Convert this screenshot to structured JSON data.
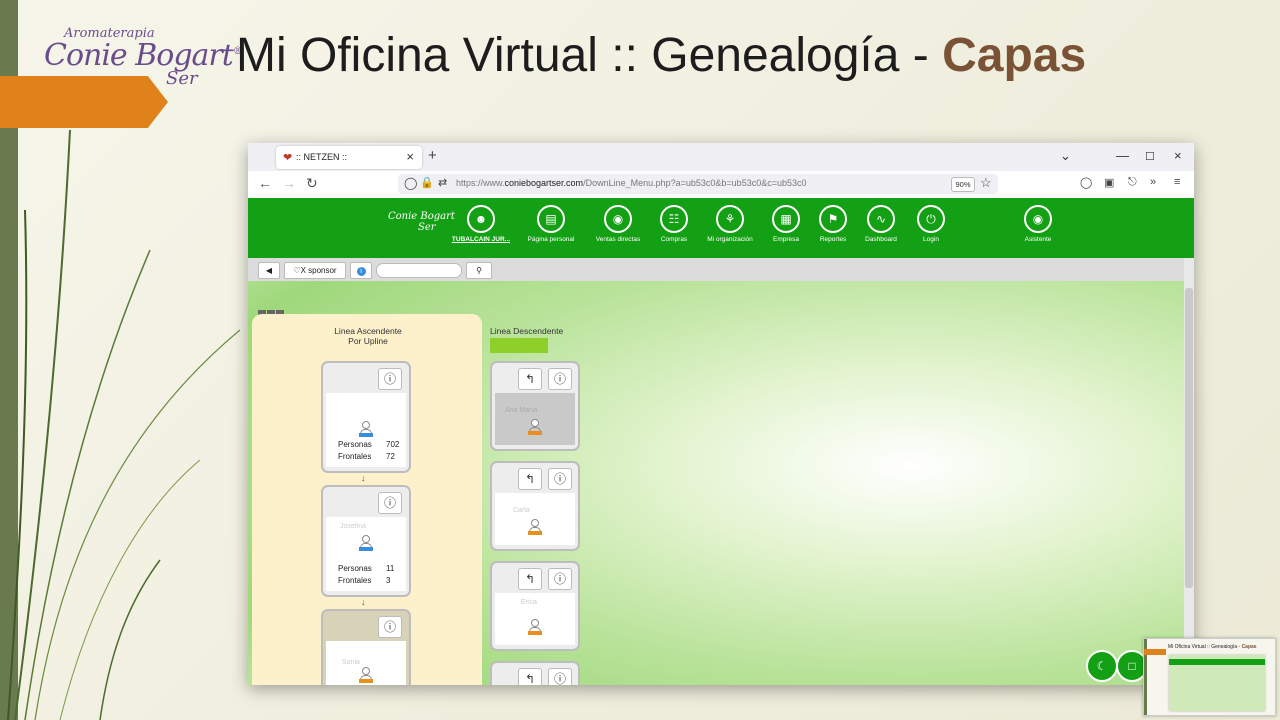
{
  "slide": {
    "logo_top": "Aromaterapia",
    "logo_main": "Conie Bogart",
    "logo_reg": "®",
    "logo_sub": "Ser",
    "title_prefix": "Mi Oficina Virtual :: Genealogía - ",
    "title_emphasis": "Capas",
    "colors": {
      "accent_orange": "#e0821c",
      "title_brown": "#7a5236",
      "strip_green": "#6a7a4f"
    }
  },
  "browser": {
    "tab_title": ":: NETZEN ::",
    "url_prefix": "https://www.",
    "url_domain": "coniebogartser.com",
    "url_path": "/DownLine_Menu.php?a=ub53c0&b=ub53c0&c=ub53c0",
    "zoom": "90%"
  },
  "site": {
    "logo": "Conie Bogart",
    "logo_sub": "Ser",
    "menu": [
      {
        "label": "TUBALCAIN JUR...",
        "icon": "user-icon"
      },
      {
        "label": "Página personal",
        "icon": "page-icon"
      },
      {
        "label": "Ventas directas",
        "icon": "bag-icon"
      },
      {
        "label": "Compras",
        "icon": "cart-icon"
      },
      {
        "label": "Mi organización",
        "icon": "org-icon"
      },
      {
        "label": "Empresa",
        "icon": "building-icon"
      },
      {
        "label": "Reportes",
        "icon": "report-icon"
      },
      {
        "label": "Dashboard",
        "icon": "dashboard-icon"
      },
      {
        "label": "Login",
        "icon": "power-icon"
      },
      {
        "label": "Asistente",
        "icon": "headset-icon"
      }
    ],
    "toolbar": {
      "sponsor": "X sponsor",
      "search_value": ""
    },
    "colors": {
      "menu_green": "#14a014",
      "descend_bar": "#8ed02a"
    }
  },
  "genealogy": {
    "asc_title_1": "Linea Ascendente",
    "asc_title_2": "Por Upline",
    "desc_title": "Linea Descendente",
    "ascendants": [
      {
        "personas_label": "Personas",
        "personas": "702",
        "frontales_label": "Frontales",
        "frontales": "72"
      },
      {
        "name": "Josefina",
        "personas_label": "Personas",
        "personas": "11",
        "frontales_label": "Frontales",
        "frontales": "3"
      },
      {
        "name": "Sonia"
      }
    ],
    "descendants": [
      {
        "name": "Ana María"
      },
      {
        "name": "Carla"
      },
      {
        "name": "Erica"
      },
      {
        "name": ""
      }
    ]
  }
}
